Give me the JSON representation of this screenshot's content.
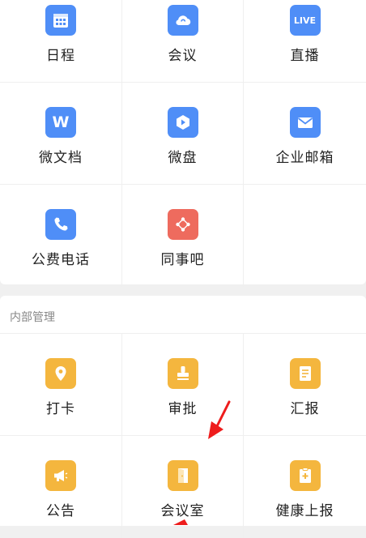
{
  "apps_row1": [
    {
      "label": "日程",
      "icon": "calendar-icon",
      "color": "#4f8ef7"
    },
    {
      "label": "会议",
      "icon": "cloud-meeting-icon",
      "color": "#4f8ef7"
    },
    {
      "label": "直播",
      "icon": "live-icon",
      "icon_text": "LIVE",
      "color": "#4f8ef7"
    }
  ],
  "apps_row2": [
    {
      "label": "微文档",
      "icon": "document-w-icon",
      "icon_text": "W",
      "color": "#4f8ef7"
    },
    {
      "label": "微盘",
      "icon": "drive-icon",
      "color": "#4f8ef7"
    },
    {
      "label": "企业邮箱",
      "icon": "mail-icon",
      "color": "#4f8ef7"
    }
  ],
  "apps_row3": [
    {
      "label": "公费电话",
      "icon": "phone-icon",
      "color": "#4f8ef7"
    },
    {
      "label": "同事吧",
      "icon": "colleague-bar-icon",
      "color": "#ee6b5e"
    }
  ],
  "internal": {
    "title": "内部管理",
    "row1": [
      {
        "label": "打卡",
        "icon": "location-pin-icon",
        "color": "#f4b63e"
      },
      {
        "label": "审批",
        "icon": "stamp-icon",
        "color": "#f4b63e"
      },
      {
        "label": "汇报",
        "icon": "report-icon",
        "color": "#f4b63e"
      }
    ],
    "row2": [
      {
        "label": "公告",
        "icon": "megaphone-icon",
        "color": "#f4b63e"
      },
      {
        "label": "会议室",
        "icon": "door-icon",
        "color": "#f4b63e"
      },
      {
        "label": "健康上报",
        "icon": "health-report-icon",
        "color": "#f4b63e"
      }
    ]
  },
  "annotation_color": "#ee1c1c"
}
